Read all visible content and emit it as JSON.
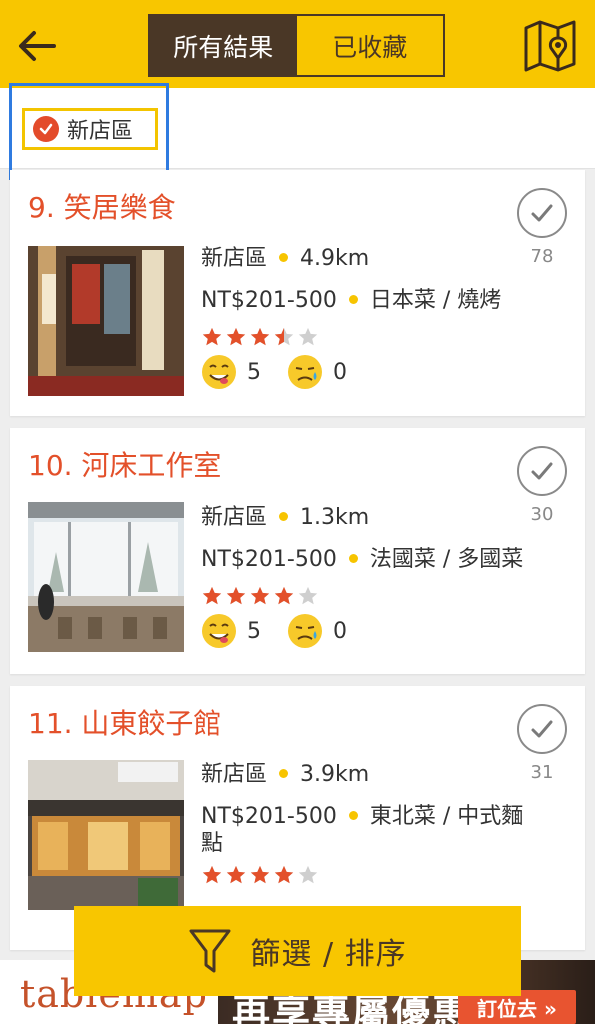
{
  "header": {
    "tabs": [
      {
        "label": "所有結果",
        "active": true
      },
      {
        "label": "已收藏",
        "active": false
      }
    ],
    "back_icon": "back-arrow-icon",
    "map_icon": "map-pin-icon",
    "accent_color": "#f8c600",
    "dark_color": "#4a3726"
  },
  "filter": {
    "chip_label": "新店區",
    "chip_icon": "check-circle-icon"
  },
  "restaurants": [
    {
      "title": "9. 笑居樂食",
      "district": "新店區",
      "distance": "4.9km",
      "price": "NT$201-500",
      "cuisine": "日本菜 / 燒烤",
      "cuisine_cont": "",
      "rating": 3.5,
      "likes": "5",
      "dislikes": "0",
      "saves": "78"
    },
    {
      "title": "10. 河床工作室",
      "district": "新店區",
      "distance": "1.3km",
      "price": "NT$201-500",
      "cuisine": "法國菜 / 多國菜",
      "cuisine_cont": "",
      "rating": 4,
      "likes": "5",
      "dislikes": "0",
      "saves": "30"
    },
    {
      "title": "11. 山東餃子館",
      "district": "新店區",
      "distance": "3.9km",
      "price": "NT$201-500",
      "cuisine": "東北菜 / 中式麵",
      "cuisine_cont": "點",
      "rating": 4,
      "likes": "",
      "dislikes": "",
      "saves": "31"
    }
  ],
  "bottom": {
    "filter_sort_label": "篩選 / 排序",
    "filter_icon": "funnel-icon"
  },
  "ad": {
    "brand": "tablemap",
    "headline": "再享專屬優惠",
    "cta": "訂位去 »"
  }
}
